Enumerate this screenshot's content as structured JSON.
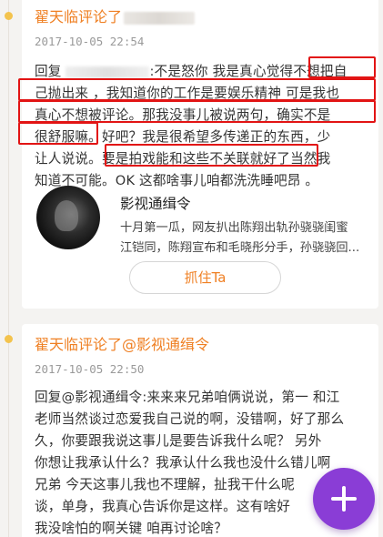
{
  "comments": [
    {
      "title": "翟天临评论了",
      "time": "2017-10-05 22:54",
      "lines": [
        "回复",
        ":不是怒你 我是真心觉得不想把自",
        "己抛出来 ，我知道你的工作是要娱乐精神 可是我也",
        "真心不想被评论。那我没事儿被说两句，确实不是",
        "很舒服嘛。好吧？我是很希望多传递正的东西，少",
        "让人说说。要是拍戏能和这些不关联就好了当然我",
        "知道不可能。OK 这都啥事儿咱都洗洗睡吧昂 。"
      ],
      "share": {
        "name": "影视通缉令",
        "desc_lines": [
          "十月第一瓜，网友扒出陈翔出轨孙骁骁闺蜜",
          "江铠同，陈翔宣布和毛晓彤分手，孙骁骁回..."
        ],
        "follow_label": "抓住Ta"
      }
    },
    {
      "title": "翟天临评论了@影视通缉令",
      "time": "2017-10-05 22:50",
      "lines": [
        "回复@影视通缉令:来来来兄弟咱俩说说，第一 和江",
        "老师当然谈过恋爱我自己说的啊，没错啊，好了那么",
        "久，你要跟我说这事儿是要告诉我什么呢？ 另外",
        "你想让我承认什么？我承认什么我也没什么错儿啊",
        "兄弟 今天这事儿我也不理解，扯我干什么呢",
        "谈，单身，我真心告诉你是这样。这有啥好",
        "我没啥怕的啊关键 咱再讨论啥？"
      ]
    }
  ],
  "fab": {
    "icon": "plus-icon"
  },
  "colors": {
    "accent": "#ef7f22",
    "highlight": "#e21414",
    "fab": "#8a3dd6",
    "dot": "#f3c34d"
  }
}
